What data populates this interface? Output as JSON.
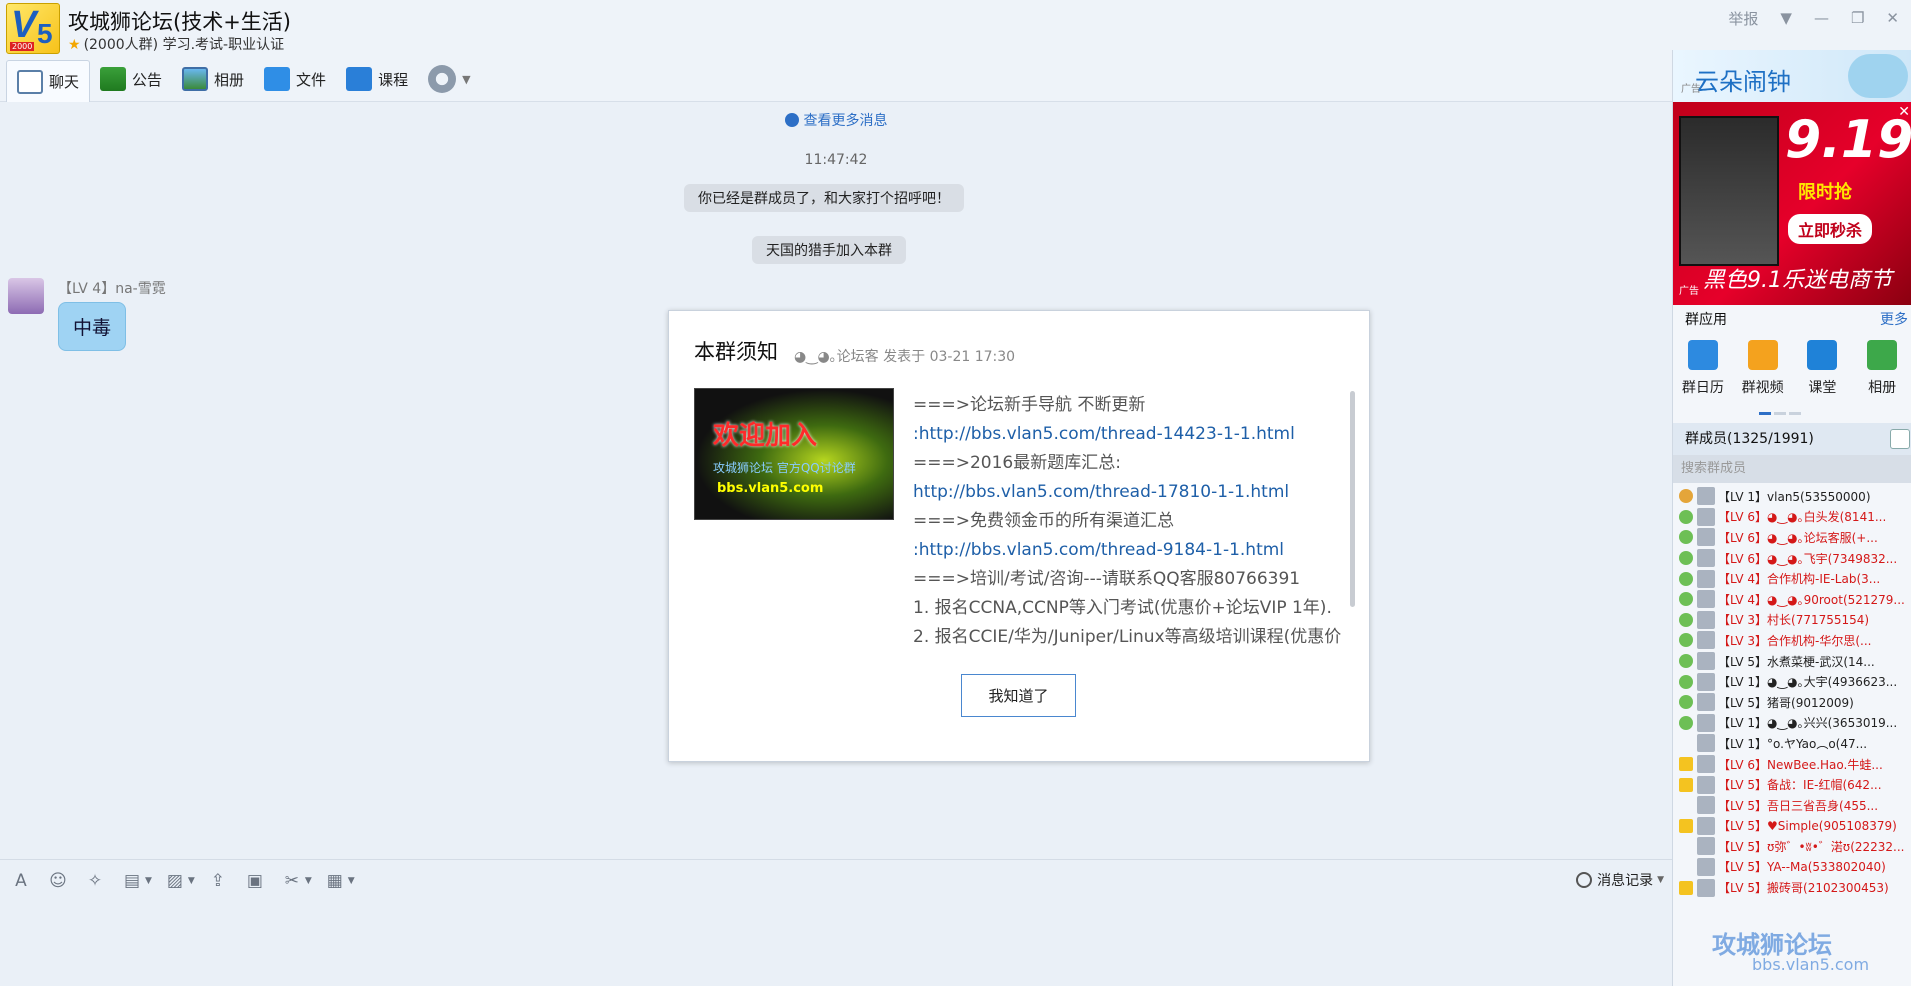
{
  "window": {
    "title": "攻城狮论坛(技术+生活)",
    "subtitle": "(2000人群) 学习.考试-职业认证",
    "logo_tag": "2000",
    "controls": {
      "report": "举报"
    }
  },
  "toolbar": {
    "items": [
      {
        "label": "聊天",
        "icon": "chat-icon"
      },
      {
        "label": "公告",
        "icon": "flag-icon"
      },
      {
        "label": "相册",
        "icon": "picture-icon"
      },
      {
        "label": "文件",
        "icon": "folder-icon"
      },
      {
        "label": "课程",
        "icon": "course-icon"
      }
    ]
  },
  "chat": {
    "more_messages": "查看更多消息",
    "timestamp": "11:47:42",
    "system_1": "你已经是群成员了，和大家打个招呼吧！",
    "system_2": "天国的猎手加入本群",
    "message": {
      "sender": "【LV 4】na-雪霓",
      "text": "中毒"
    }
  },
  "notice": {
    "title": "本群须知",
    "meta": "◕‿◕｡论坛客 发表于 03-21 17:30",
    "image_text_1": "欢迎加入",
    "image_text_2": "攻城狮论坛 官方QQ讨论群",
    "image_text_3": "bbs.vlan5.com",
    "lines": [
      {
        "text": "===>论坛新手导航 不断更新",
        "type": "text"
      },
      {
        "text": ":http://bbs.vlan5.com/thread-14423-1-1.html",
        "type": "link"
      },
      {
        "text": "===>2016最新题库汇总:",
        "type": "text"
      },
      {
        "text": "http://bbs.vlan5.com/thread-17810-1-1.html",
        "type": "link"
      },
      {
        "text": "===>免费领金币的所有渠道汇总",
        "type": "text"
      },
      {
        "text": ":http://bbs.vlan5.com/thread-9184-1-1.html",
        "type": "link"
      },
      {
        "text": "===>培训/考试/咨询---请联系QQ客服80766391",
        "type": "text"
      },
      {
        "text": "1. 报名CCNA,CCNP等入门考试(优惠价+论坛VIP 1年).",
        "type": "text"
      },
      {
        "text": "2. 报名CCIE/华为/Juniper/Linux等高级培训课程(优惠价",
        "type": "text"
      }
    ],
    "confirm_button": "我知道了"
  },
  "input_bar": {
    "history": "消息记录"
  },
  "sidebar": {
    "ad_top_text": "云朵闹钟",
    "ad_label": "广告",
    "ad_main_big": "9.19",
    "ad_main_sub": "限时抢",
    "ad_main_grab": "立即秒杀",
    "ad_main_foot": "黑色9.1乐迷电商节",
    "apps_title": "群应用",
    "apps_more": "更多",
    "apps": [
      {
        "label": "群日历",
        "color": "#2d8ae0"
      },
      {
        "label": "群视频",
        "color": "#f4a21e"
      },
      {
        "label": "课堂",
        "color": "#1f82d8"
      },
      {
        "label": "相册",
        "color": "#3da84a"
      }
    ],
    "members_title": "群成员(1325/1991)",
    "search_placeholder": "搜索群成员",
    "members": [
      {
        "name": "【LV 1】vlan5(53550000)",
        "role": "owner",
        "color": "black"
      },
      {
        "name": "【LV 6】◕‿◕｡白头发(8141...",
        "role": "admin",
        "color": "red"
      },
      {
        "name": "【LV 6】◕‿◕｡论坛客服(+...",
        "role": "admin",
        "color": "red"
      },
      {
        "name": "【LV 6】◕‿◕｡飞宇(7349832...",
        "role": "admin",
        "color": "red"
      },
      {
        "name": "【LV 4】合作机构-IE-Lab(3...",
        "role": "admin",
        "color": "red"
      },
      {
        "name": "【LV 4】◕‿◕｡90root(521279...",
        "role": "admin",
        "color": "red"
      },
      {
        "name": "【LV 3】村长(771755154)",
        "role": "admin",
        "color": "red"
      },
      {
        "name": "【LV 3】合作机构-华尔思(...",
        "role": "admin",
        "color": "red"
      },
      {
        "name": "【LV 5】水煮菜梗-武汉(14...",
        "role": "admin",
        "color": "black"
      },
      {
        "name": "【LV 1】◕‿◕｡大宇(4936623...",
        "role": "admin",
        "color": "black"
      },
      {
        "name": "【LV 5】猪哥(9012009)",
        "role": "admin",
        "color": "black"
      },
      {
        "name": "【LV 1】◕‿◕｡兴兴(3653019...",
        "role": "admin",
        "color": "black"
      },
      {
        "name": "【LV 1】°o.ヤYao︵o(47...",
        "role": "none",
        "color": "black"
      },
      {
        "name": "【LV 6】NewBee.Hao.牛蛙...",
        "role": "star",
        "color": "red"
      },
      {
        "name": "【LV 5】备战：IE-红帽(642...",
        "role": "star",
        "color": "red"
      },
      {
        "name": "【LV 5】吾日三省吾身(455...",
        "role": "none",
        "color": "red"
      },
      {
        "name": "【LV 5】♥Simple(905108379)",
        "role": "star",
        "color": "red"
      },
      {
        "name": "【LV 5】ʊ弥゛•ʬ•゛渃ʊ(22232...",
        "role": "none",
        "color": "red"
      },
      {
        "name": "【LV 5】YA--Ma(533802040)",
        "role": "none",
        "color": "red"
      },
      {
        "name": "【LV 5】搬砖哥(2102300453)",
        "role": "star",
        "color": "red"
      }
    ]
  },
  "watermark": {
    "line1": "攻城狮论坛",
    "line2": "bbs.vlan5.com"
  }
}
